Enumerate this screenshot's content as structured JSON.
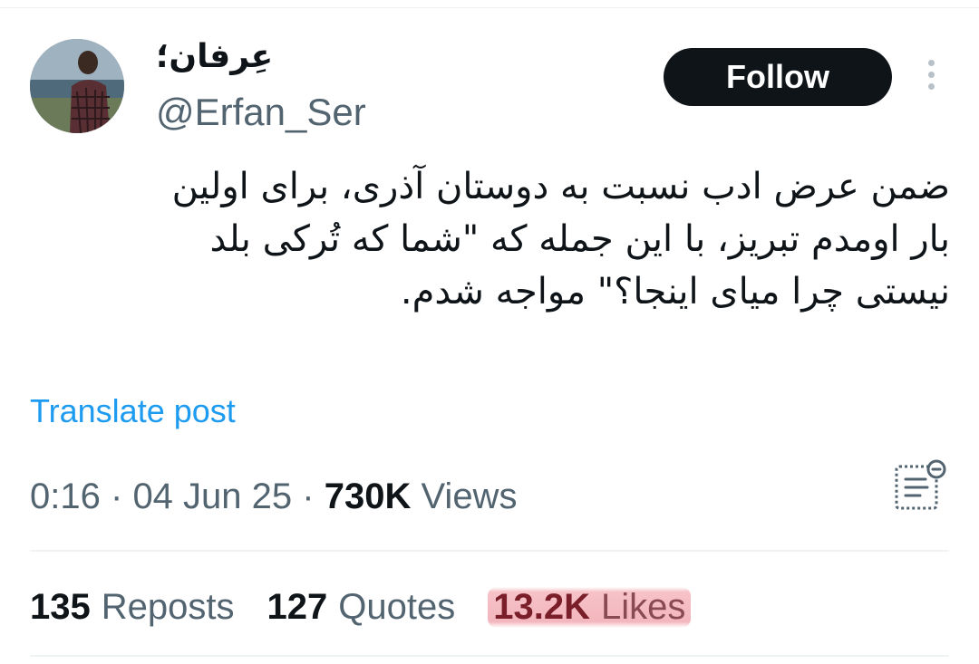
{
  "author": {
    "display_name": "عِرفان؛",
    "handle": "@Erfan_Ser",
    "avatar_icon": "profile-photo"
  },
  "follow_label": "Follow",
  "more_icon": "more-vertical-icon",
  "tweet": {
    "text": "ضمن عرض ادب نسبت به دوستان آذری، برای اولین\nبار اومدم تبریز، با این جمله که \"شما که تُرکی بلد\nنیستی چرا میای اینجا؟\" مواجه شدم."
  },
  "translate_label": "Translate post",
  "meta": {
    "time": "0:16",
    "separator": "·",
    "date": "04 Jun 25",
    "views_count": "730K",
    "views_label": "Views"
  },
  "analytics_icon": "analytics-icon",
  "stats": {
    "reposts_count": "135",
    "reposts_label": "Reposts",
    "quotes_count": "127",
    "quotes_label": "Quotes",
    "likes_count": "13.2K",
    "likes_label": "Likes"
  },
  "colors": {
    "link": "#1d9bf0",
    "secondary_text": "#536471",
    "primary_text": "#0f1419",
    "highlight": "#f3b6bd"
  }
}
